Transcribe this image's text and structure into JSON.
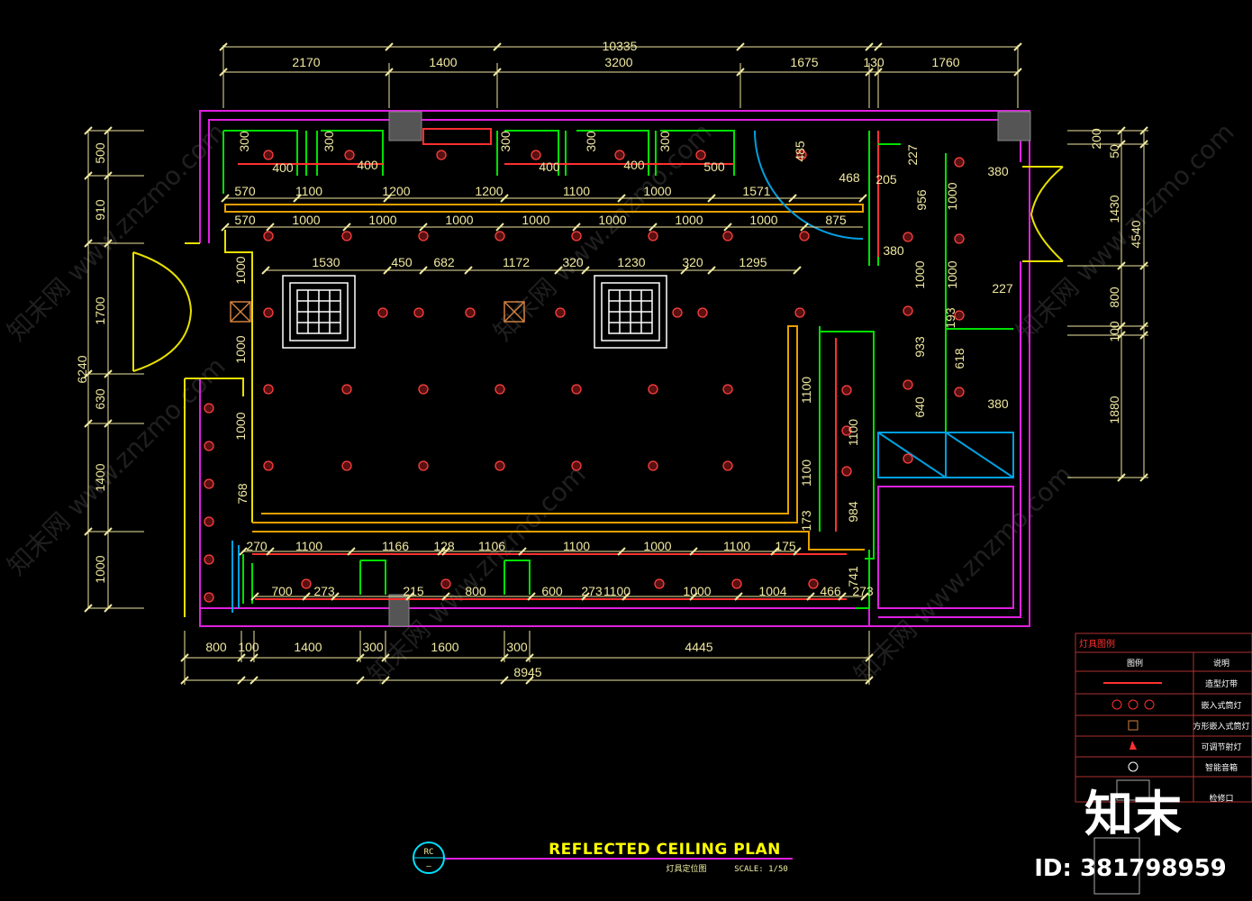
{
  "drawing": {
    "title": "REFLECTED CEILING PLAN",
    "subtitle_cn": "灯具定位图",
    "scale": "SCALE: 1/50",
    "tag": "RC",
    "tag_sub": "—"
  },
  "watermark": {
    "text": "知末网 www.znzmo.com",
    "logo": "知末",
    "id": "ID: 381798959"
  },
  "legend": {
    "title": "灯具图例",
    "col_symbol": "图例",
    "col_desc": "说明",
    "rows": [
      "造型灯带",
      "嵌入式筒灯",
      "方形嵌入式筒灯",
      "可调节射灯",
      "智能音箱",
      "检修口"
    ]
  },
  "dims": {
    "top_total": "10335",
    "top": [
      "2170",
      "1400",
      "3200",
      "1675",
      "130",
      "1760"
    ],
    "bottom_total": "8945",
    "bottom": [
      "800",
      "100",
      "1400",
      "300",
      "1600",
      "300",
      "4445"
    ],
    "left_total": "6240",
    "left": [
      "500",
      "910",
      "1700",
      "630",
      "1400",
      "1000"
    ],
    "right_total": "4540",
    "right": [
      "200",
      "50",
      "1430",
      "800",
      "100",
      "1880"
    ],
    "row1": [
      "570",
      "1100",
      "1200",
      "1200",
      "1100",
      "1000",
      "1571"
    ],
    "row2": [
      "570",
      "1000",
      "1000",
      "1000",
      "1000",
      "1000",
      "1000",
      "1000",
      "875"
    ],
    "row3": [
      "1530",
      "450",
      "682",
      "1172",
      "320",
      "1230",
      "320",
      "1295"
    ],
    "row4": [
      "270",
      "1100",
      "1166",
      "128",
      "1106",
      "1100",
      "1000",
      "1100",
      "175"
    ],
    "row5": [
      "700",
      "273",
      "215",
      "800",
      "600",
      "273",
      "1100",
      "1000",
      "1004",
      "466",
      "273"
    ],
    "top_bays": [
      "300",
      "400",
      "300",
      "400",
      "300",
      "400",
      "300",
      "400",
      "300",
      "500"
    ],
    "misc": [
      "485",
      "468",
      "205",
      "227",
      "956",
      "1000",
      "380",
      "380",
      "1000",
      "1000",
      "227",
      "193",
      "933",
      "618",
      "640",
      "380",
      "1000",
      "1000",
      "1000",
      "1100",
      "1100",
      "984",
      "741",
      "173",
      "768",
      "1000",
      "1000"
    ]
  }
}
